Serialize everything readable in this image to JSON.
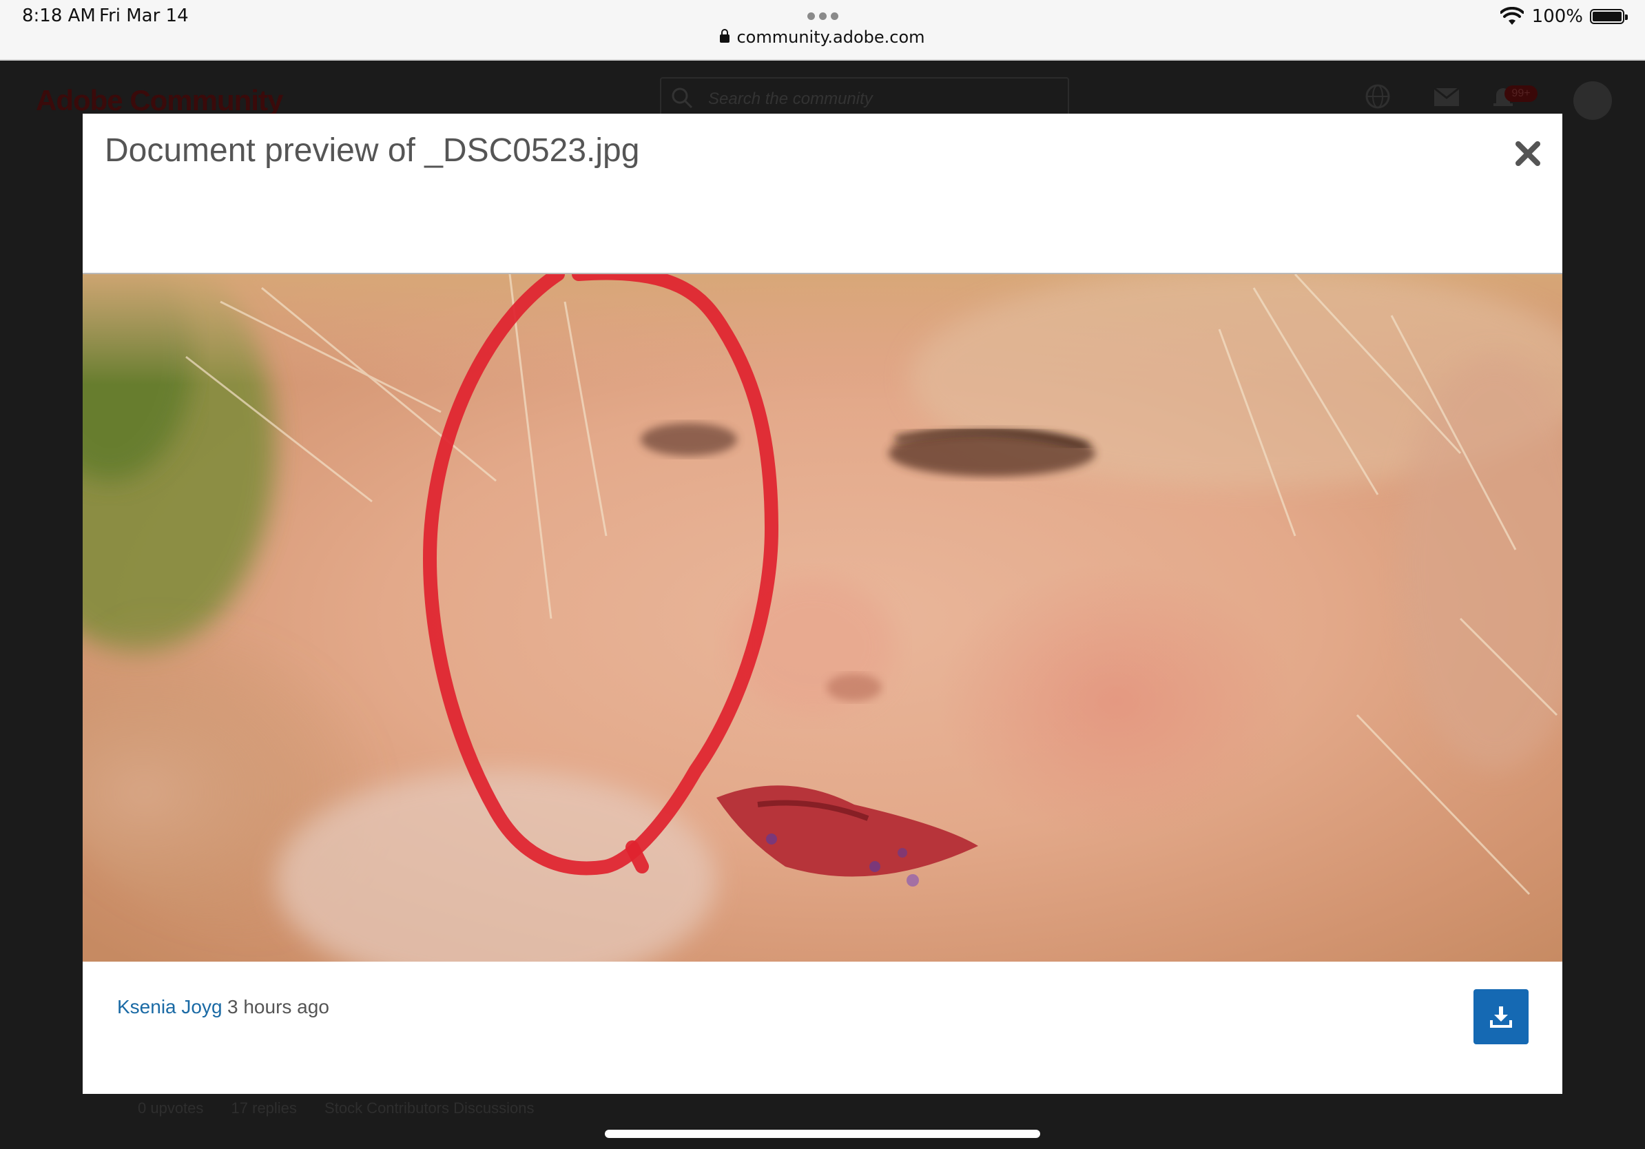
{
  "status_bar": {
    "time": "8:18 AM",
    "date": "Fri Mar 14",
    "url": "community.adobe.com",
    "battery": "100%"
  },
  "background_page": {
    "logo": "Adobe Community",
    "search_placeholder": "Search the community",
    "notification_badge": "99+",
    "footer_upvotes": "0 upvotes",
    "footer_replies": "17 replies",
    "footer_category": "Stock Contributors Discussions"
  },
  "modal": {
    "title": "Document preview of _DSC0523.jpg",
    "author": "Ksenia Joyg",
    "time_ago": "3 hours ago"
  },
  "colors": {
    "accent": "#1569b3",
    "link": "#1a6aa5",
    "annotation": "#e0232f"
  },
  "icons": {
    "close": "close-icon",
    "download": "download-icon"
  }
}
